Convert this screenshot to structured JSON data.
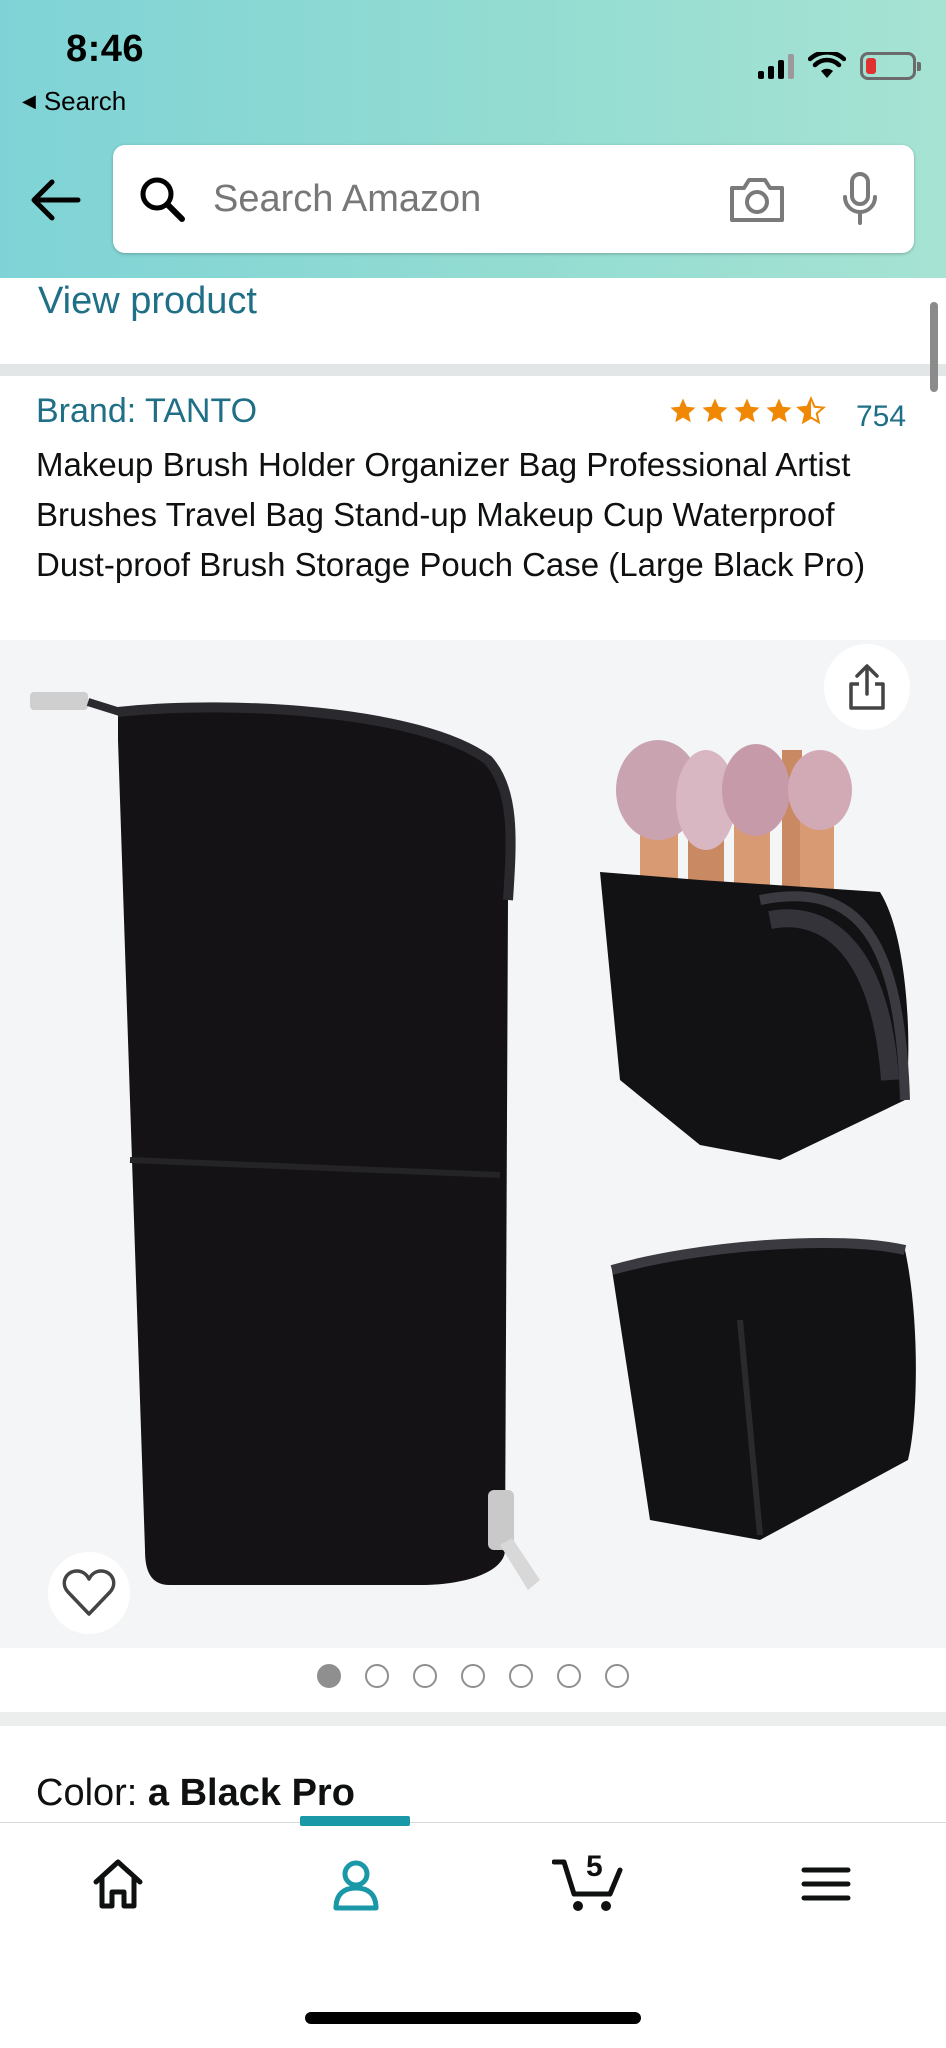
{
  "status_bar": {
    "time": "8:46",
    "back_label": "Search"
  },
  "search": {
    "placeholder": "Search Amazon"
  },
  "view_product": "View product",
  "product": {
    "brand": "Brand: TANTO",
    "rating_value": 4.5,
    "rating_count": "754",
    "title": "Makeup Brush Holder Organizer Bag Professional Artist Brushes Travel Bag Stand-up Makeup Cup Waterproof Dust-proof Brush Storage Pouch Case (Large Black Pro)"
  },
  "gallery": {
    "image_count": 7,
    "active_index": 0
  },
  "color": {
    "label": "Color: ",
    "value": "a Black Pro"
  },
  "tabbar": {
    "cart_count": "5",
    "active_tab": "account"
  },
  "colors": {
    "link": "#1f6f86",
    "accent": "#1a98a8",
    "star": "#f08804"
  },
  "icons": [
    "back-arrow-icon",
    "search-icon",
    "camera-icon",
    "mic-icon",
    "share-icon",
    "heart-icon",
    "home-icon",
    "account-icon",
    "cart-icon",
    "menu-icon"
  ]
}
